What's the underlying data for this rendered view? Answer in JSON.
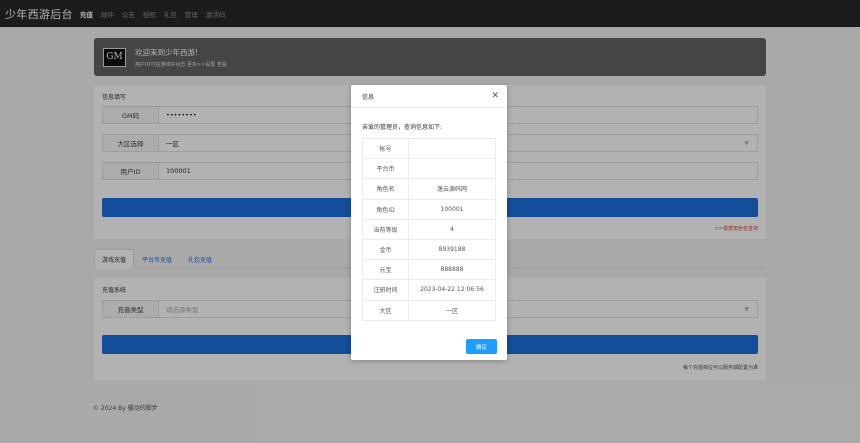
{
  "navbar": {
    "brand": "少年西游后台",
    "items": [
      {
        "label": "充值",
        "active": true
      },
      {
        "label": "邮件",
        "active": false
      },
      {
        "label": "公告",
        "active": false
      },
      {
        "label": "授权",
        "active": false
      },
      {
        "label": "礼包",
        "active": false
      },
      {
        "label": "管理",
        "active": false
      },
      {
        "label": "激活码",
        "active": false
      }
    ]
  },
  "banner": {
    "logo_text": "GM",
    "title": "欢迎来到少年西游!",
    "subtitle": "用户ID可在游戏中点击 更多>>设置 查看"
  },
  "info_form": {
    "heading": "信息填写",
    "gm_label": "GM码",
    "gm_value": "••••••••",
    "region_label": "大区选择",
    "region_value": "一区",
    "uid_label": "用户ID",
    "uid_value": "100001",
    "red_link": ">>根据角色名查询"
  },
  "tabs": [
    {
      "label": "游戏充值",
      "active": true
    },
    {
      "label": "平台币充值",
      "active": false
    },
    {
      "label": "礼包充值",
      "active": false
    }
  ],
  "recharge": {
    "heading": "充值系统",
    "type_label": "充值类型",
    "type_placeholder": "请选择类型",
    "note": "每个充值档位可以服务端配置为准"
  },
  "footer": "© 2024 By 骚动的脚步",
  "modal": {
    "title": "信息",
    "message": "亲爱的管理员，查询信息如下:",
    "rows": [
      {
        "key": "帐号",
        "value": ""
      },
      {
        "key": "平台币",
        "value": ""
      },
      {
        "key": "角色名",
        "value": "逸云源码网"
      },
      {
        "key": "角色ID",
        "value": "100001"
      },
      {
        "key": "当前等级",
        "value": "4"
      },
      {
        "key": "金币",
        "value": "8939188"
      },
      {
        "key": "元宝",
        "value": "888888"
      },
      {
        "key": "注册时间",
        "value": "2023-04-22 12:06:56"
      },
      {
        "key": "大区",
        "value": "一区"
      }
    ],
    "ok_label": "确定"
  },
  "colors": {
    "navbar_bg": "#26292b",
    "banner_bg": "#606366",
    "primary_blue": "#1e6fdc",
    "ok_button": "#1e9fff",
    "link_red": "#e04a4a"
  }
}
